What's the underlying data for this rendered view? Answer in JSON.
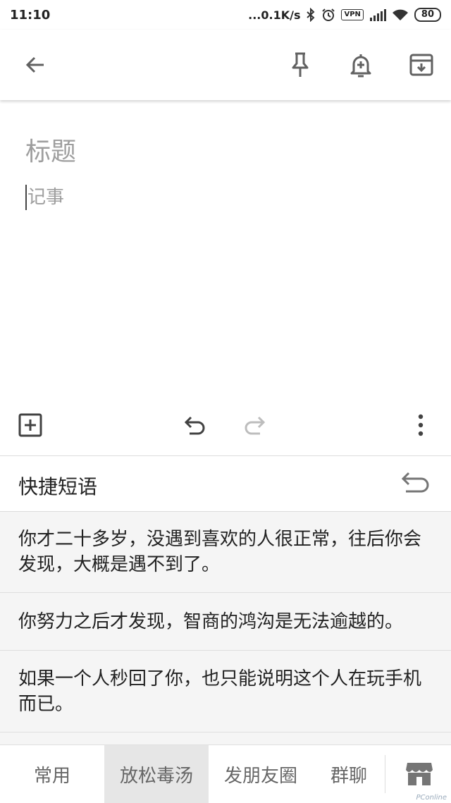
{
  "status_bar": {
    "time": "11:10",
    "network_speed": "...0.1K/s",
    "vpn": "VPN",
    "battery": "80"
  },
  "editor": {
    "title_placeholder": "标题",
    "note_placeholder": "记事"
  },
  "quick_phrases": {
    "title": "快捷短语",
    "items": [
      "你才二十多岁，没遇到喜欢的人很正常，往后你会发现，大概是遇不到了。",
      "你努力之后才发现，智商的鸿沟是无法逾越的。",
      "如果一个人秒回了你，也只能说明这个人在玩手机而已。"
    ]
  },
  "tabs": [
    {
      "label": "常用",
      "active": false
    },
    {
      "label": "放松毒汤",
      "active": true
    },
    {
      "label": "发朋友圈",
      "active": false
    },
    {
      "label": "群聊",
      "active": false
    }
  ],
  "icons": {
    "back": "arrow-left-icon",
    "pin": "pin-icon",
    "reminder": "bell-plus-icon",
    "archive": "archive-icon",
    "add": "add-box-icon",
    "undo": "undo-icon",
    "redo": "redo-icon",
    "more": "more-vertical-icon",
    "store": "store-icon"
  },
  "watermark": "PConline"
}
